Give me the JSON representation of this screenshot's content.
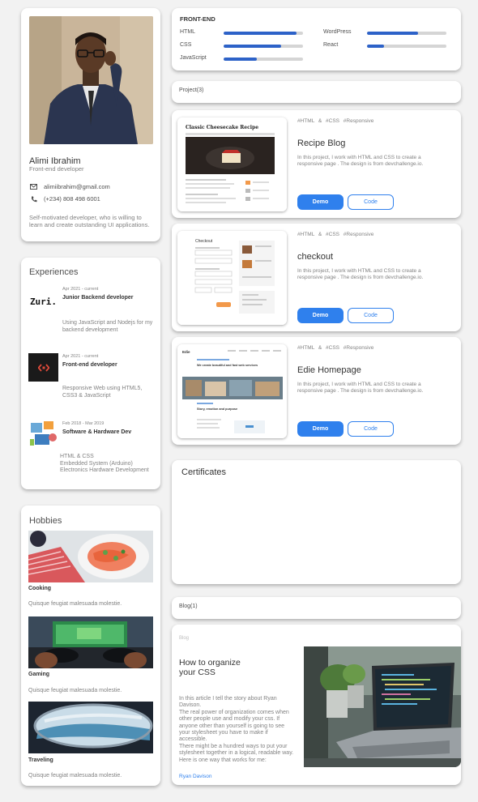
{
  "profile": {
    "name": "Alimi Ibrahim",
    "role": "Front-end developer",
    "email": "alimiibrahim@gmail.com",
    "phone": "(+234) 808 498 6001",
    "bio": "Self-motivated developer, who is willing to learn and create outstanding UI applications."
  },
  "experiences": {
    "title": "Experiences",
    "items": [
      {
        "logo_text": "Zuri.",
        "date": "Apr 2021 - current",
        "title": "Junior Backend developer",
        "desc": "Using JavaScript and Nodejs for my backend development"
      },
      {
        "date": "Apr 2021 - current",
        "title": "Front-end developer",
        "desc": "Responsive Web using HTML5, CSS3 & JavaScript"
      },
      {
        "date": "Feb 2018 - Mar 2019",
        "title": "Software & Hardware Dev",
        "desc": "HTML & CSS\nEmbedded System (Arduino)\nElectronics Hardware Development"
      }
    ]
  },
  "hobbies": {
    "title": "Hobbies",
    "items": [
      {
        "title": "Cooking",
        "desc": "Quisque feugiat malesuada molestie."
      },
      {
        "title": "Gaming",
        "desc": "Quisque feugiat malesuada molestie."
      },
      {
        "title": "Traveling",
        "desc": "Quisque feugiat malesuada molestie."
      }
    ]
  },
  "skills": {
    "title": "FRONT-END",
    "items": [
      {
        "name": "HTML",
        "level": 0.92
      },
      {
        "name": "CSS",
        "level": 0.72
      },
      {
        "name": "JavaScript",
        "level": 0.42
      },
      {
        "name": "WordPress",
        "level": 0.64
      },
      {
        "name": "React",
        "level": 0.21
      }
    ],
    "bar_color": "#2d62c8"
  },
  "projects": {
    "header": "Project(3)",
    "demo_label": "Demo",
    "code_label": "Code",
    "tags": "#HTML  &  #CSS  #Responsive",
    "items": [
      {
        "title": "Recipe Blog",
        "desc": "In this project, I work with HTML and CSS to create a responsive page . The design is from devchallenge.io.",
        "thumb_heading": "Classic Cheesecake Recipe"
      },
      {
        "title": "checkout",
        "desc": "In this project, I work with HTML and CSS to create a responsive page . The design is from devchallenge.io.",
        "thumb_heading": "Checkout"
      },
      {
        "title": "Edie Homepage",
        "desc": "In this project, I work with HTML and CSS to create a responsive page . The design is from devchallenge.io.",
        "thumb_heading": "We create beautiful and fast web services",
        "thumb_heading2": "Story, emotion and purpose",
        "thumb_logo": "Edie"
      }
    ]
  },
  "certificates": {
    "title": "Certificates"
  },
  "blog": {
    "header": "Blog(1)",
    "label": "Blog",
    "title": "How to organize your CSS",
    "text": "In this article I tell the story about Ryan Davison.\nThe real power of organization comes when other people use and modify your css. If anyone other than yourself is going to see your stylesheet you have to make if accessible.\nThere might be a hundred ways to put your stylesheet together in a logical, readable way. Here is one way that works for me:",
    "author": "Ryan Davison"
  },
  "colors": {
    "accent": "#2f80ed",
    "background": "#f2f2f2"
  }
}
